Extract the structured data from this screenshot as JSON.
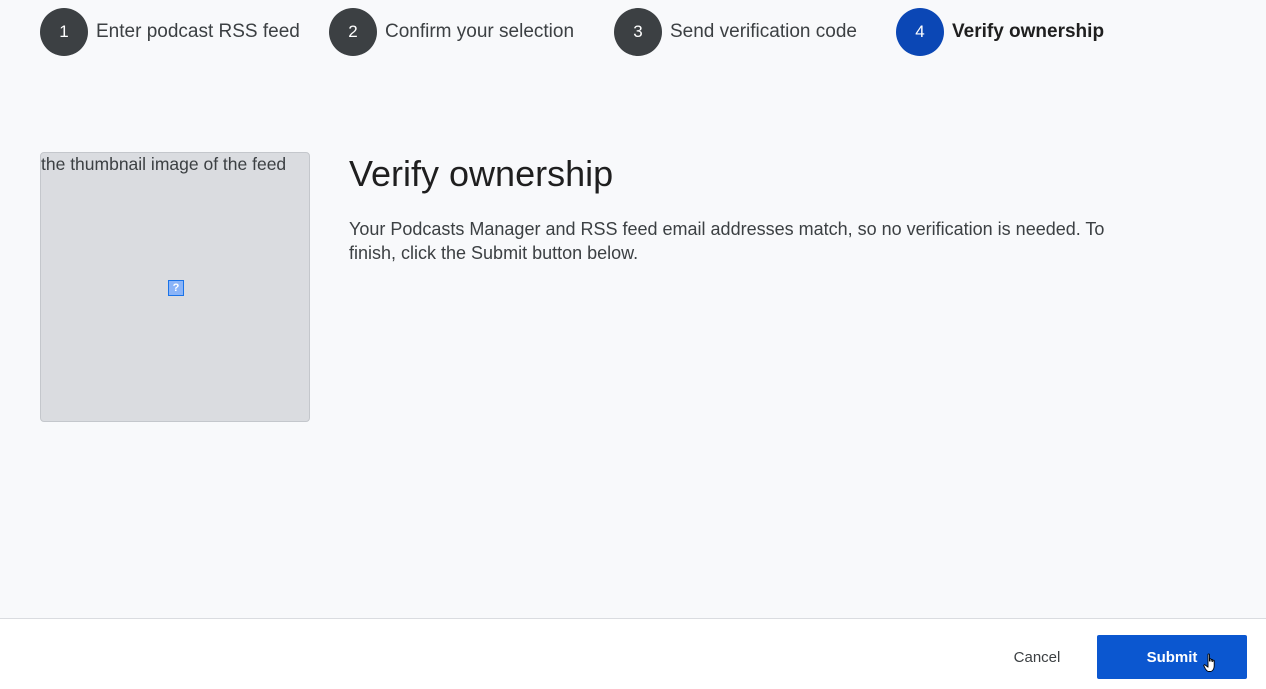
{
  "stepper": {
    "steps": [
      {
        "number": "1",
        "label": "Enter podcast RSS feed"
      },
      {
        "number": "2",
        "label": "Confirm your selection"
      },
      {
        "number": "3",
        "label": "Send verification code"
      },
      {
        "number": "4",
        "label": "Verify ownership",
        "active": true
      }
    ]
  },
  "thumbnail": {
    "alt_text": "the thumbnail image of the feed",
    "broken_icon": "?"
  },
  "main": {
    "title": "Verify ownership",
    "description": "Your Podcasts Manager and RSS feed email addresses match, so no verification is needed. To finish, click the Submit button below."
  },
  "footer": {
    "cancel_label": "Cancel",
    "submit_label": "Submit"
  },
  "colors": {
    "active_step": "#0b47b5",
    "inactive_step": "#3c4043",
    "primary_button": "#0b57d0"
  },
  "icons": {
    "cursor": "hand-pointer-icon",
    "broken_image": "broken-image-icon"
  }
}
